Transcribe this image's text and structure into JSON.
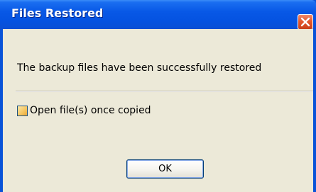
{
  "window": {
    "title": "Files Restored",
    "close_icon": "close-icon",
    "accent_color": "#0553e1",
    "close_color": "#e3582e"
  },
  "dialog": {
    "message": "The backup files have been successfully restored",
    "checkbox_label": "Open file(s) once copied",
    "checkbox_checked": false,
    "ok_label": "OK"
  }
}
